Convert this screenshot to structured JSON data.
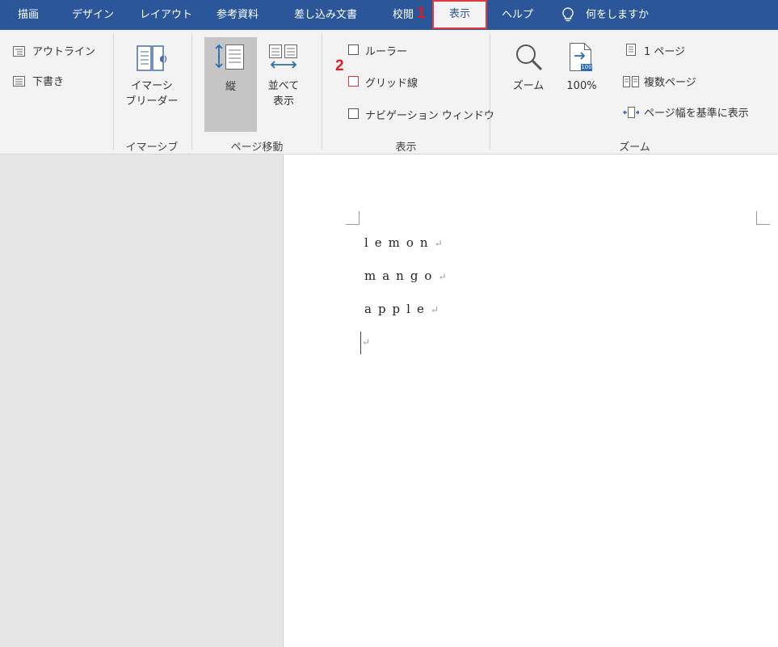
{
  "tabs": [
    "描画",
    "デザイン",
    "レイアウト",
    "参考資料",
    "差し込み文書",
    "校閲",
    "表示",
    "ヘルプ"
  ],
  "active_tab": "表示",
  "tell_me": "何をしますか",
  "markers": {
    "one": "1",
    "two": "2"
  },
  "ribbon": {
    "views": {
      "outline": "アウトライン",
      "draft": "下書き"
    },
    "immersive": {
      "reader_line1": "イマーシ",
      "reader_line2": "ブリーダー",
      "group": "イマーシブ"
    },
    "page_movement": {
      "vertical": "縦",
      "side_line1": "並べて",
      "side_line2": "表示",
      "group": "ページ移動"
    },
    "show": {
      "ruler": "ルーラー",
      "gridlines": "グリッド線",
      "navigation": "ナビゲーション ウィンドウ",
      "group": "表示"
    },
    "zoom": {
      "zoom": "ズーム",
      "hundred": "100%",
      "one_page": "1 ページ",
      "multiple_pages": "複数ページ",
      "page_width": "ページ幅を基準に表示",
      "group": "ズーム",
      "icon_badge": "100"
    }
  },
  "document": {
    "lines": [
      "lemon",
      "mango",
      "apple"
    ],
    "paragraph_mark": "↵"
  }
}
